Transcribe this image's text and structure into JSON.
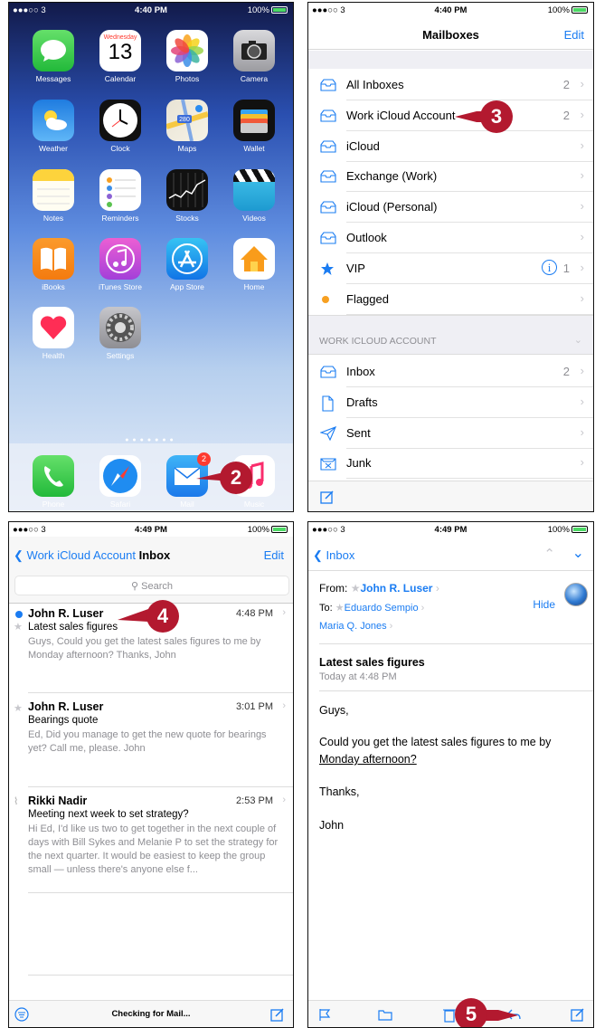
{
  "home": {
    "carrier": "●●●○○ 3",
    "time": "4:40 PM",
    "battery": "100%",
    "apps": [
      {
        "label": "Messages"
      },
      {
        "label": "Calendar",
        "weekday": "Wednesday",
        "day": "13"
      },
      {
        "label": "Photos"
      },
      {
        "label": "Camera"
      },
      {
        "label": "Weather"
      },
      {
        "label": "Clock"
      },
      {
        "label": "Maps",
        "route": "280"
      },
      {
        "label": "Wallet"
      },
      {
        "label": "Notes"
      },
      {
        "label": "Reminders"
      },
      {
        "label": "Stocks"
      },
      {
        "label": "Videos"
      },
      {
        "label": "iBooks"
      },
      {
        "label": "iTunes Store"
      },
      {
        "label": "App Store"
      },
      {
        "label": "Home"
      },
      {
        "label": "Health"
      },
      {
        "label": "Settings"
      }
    ],
    "dock": [
      {
        "label": "Phone"
      },
      {
        "label": "Safari"
      },
      {
        "label": "Mail",
        "badge": "2"
      },
      {
        "label": "Music"
      }
    ],
    "callout": "2"
  },
  "mailboxes": {
    "carrier": "●●●○○ 3",
    "time": "4:40 PM",
    "battery": "100%",
    "title": "Mailboxes",
    "edit": "Edit",
    "rows": [
      {
        "label": "All Inboxes",
        "count": "2",
        "icon": "inbox-tray-icon"
      },
      {
        "label": "Work iCloud Account",
        "count": "2",
        "icon": "inbox-tray-icon"
      },
      {
        "label": "iCloud",
        "count": "",
        "icon": "inbox-tray-icon"
      },
      {
        "label": "Exchange (Work)",
        "count": "",
        "icon": "inbox-tray-icon"
      },
      {
        "label": "iCloud (Personal)",
        "count": "",
        "icon": "inbox-tray-icon"
      },
      {
        "label": "Outlook",
        "count": "",
        "icon": "inbox-tray-icon"
      },
      {
        "label": "VIP",
        "count": "1",
        "icon": "star-icon"
      },
      {
        "label": "Flagged",
        "count": "",
        "icon": "flag-dot-icon"
      }
    ],
    "section": "WORK ICLOUD ACCOUNT",
    "account_rows": [
      {
        "label": "Inbox",
        "count": "2"
      },
      {
        "label": "Drafts",
        "count": ""
      },
      {
        "label": "Sent",
        "count": ""
      },
      {
        "label": "Junk",
        "count": ""
      }
    ],
    "callout": "3"
  },
  "inbox": {
    "carrier": "●●●○○ 3",
    "time": "4:49 PM",
    "battery": "100%",
    "back": "Work iCloud Account",
    "title": "Inbox",
    "edit": "Edit",
    "search": "Search",
    "messages": [
      {
        "sender": "John R. Luser",
        "time": "4:48 PM",
        "subject": "Latest sales figures",
        "preview": "Guys, Could you get the latest sales figures to me by Monday afternoon? Thanks, John"
      },
      {
        "sender": "John R. Luser",
        "time": "3:01 PM",
        "subject": "Bearings quote",
        "preview": "Ed, Did you manage to get the new quote for bearings yet? Call me, please. John"
      },
      {
        "sender": "Rikki Nadir",
        "time": "2:53 PM",
        "subject": "Meeting next week to set strategy?",
        "preview": "Hi Ed, I'd like us two to get together in the next couple of days with Bill Sykes and Melanie P to set the strategy for the next quarter. It would be easiest to keep the group small — unless there's anyone else f..."
      }
    ],
    "status": "Checking for Mail...",
    "callout": "4"
  },
  "message": {
    "carrier": "●●●○○ 3",
    "time": "4:49 PM",
    "battery": "100%",
    "back": "Inbox",
    "from_label": "From:",
    "from": "John R. Luser",
    "to_label": "To:",
    "to": "Eduardo Sempio",
    "cc": "Maria Q. Jones",
    "hide": "Hide",
    "subject": "Latest sales figures",
    "date": "Today at 4:48 PM",
    "body": {
      "greeting": "Guys,",
      "line1": "Could you get the latest sales figures to me by",
      "line2": "Monday afternoon?",
      "line2_suffix": "?",
      "thanks": "Thanks,",
      "sign": "John"
    },
    "callout": "5"
  }
}
